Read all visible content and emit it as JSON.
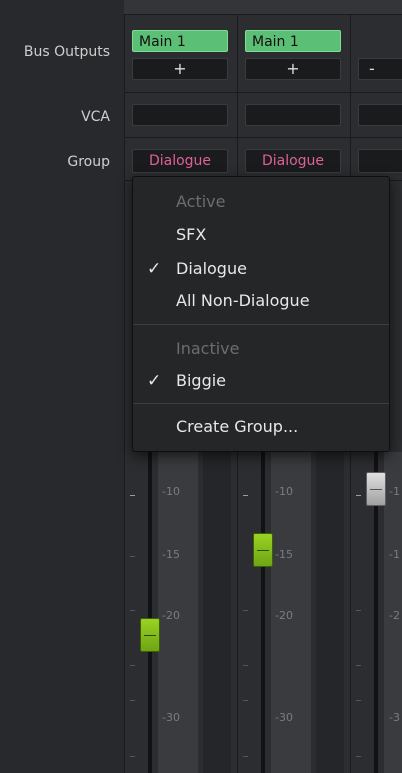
{
  "row_labels": {
    "bus_outputs": "Bus Outputs",
    "vca": "VCA",
    "group": "Group"
  },
  "strips": [
    {
      "bus_output": "Main 1",
      "add_label": "+",
      "group": "Dialogue"
    },
    {
      "bus_output": "Main 1",
      "add_label": "+",
      "group": "Dialogue"
    },
    {
      "add_label": "-"
    }
  ],
  "group_menu": {
    "active_header": "Active",
    "items_active": [
      {
        "label": "SFX",
        "checked": false
      },
      {
        "label": "Dialogue",
        "checked": true
      },
      {
        "label": "All Non-Dialogue",
        "checked": false
      }
    ],
    "inactive_header": "Inactive",
    "items_inactive": [
      {
        "label": "Biggie",
        "checked": true
      }
    ],
    "create_label": "Create Group...",
    "check_glyph": "✓"
  },
  "fader_scale": {
    "labels": [
      "-10",
      "-15",
      "-20",
      "-30"
    ],
    "partial_labels": [
      "-1",
      "-1",
      "-2",
      "-3"
    ],
    "faders": [
      {
        "level_db": -21.5
      },
      {
        "level_db": -14.5
      },
      {
        "level_db": -9.5
      }
    ]
  }
}
